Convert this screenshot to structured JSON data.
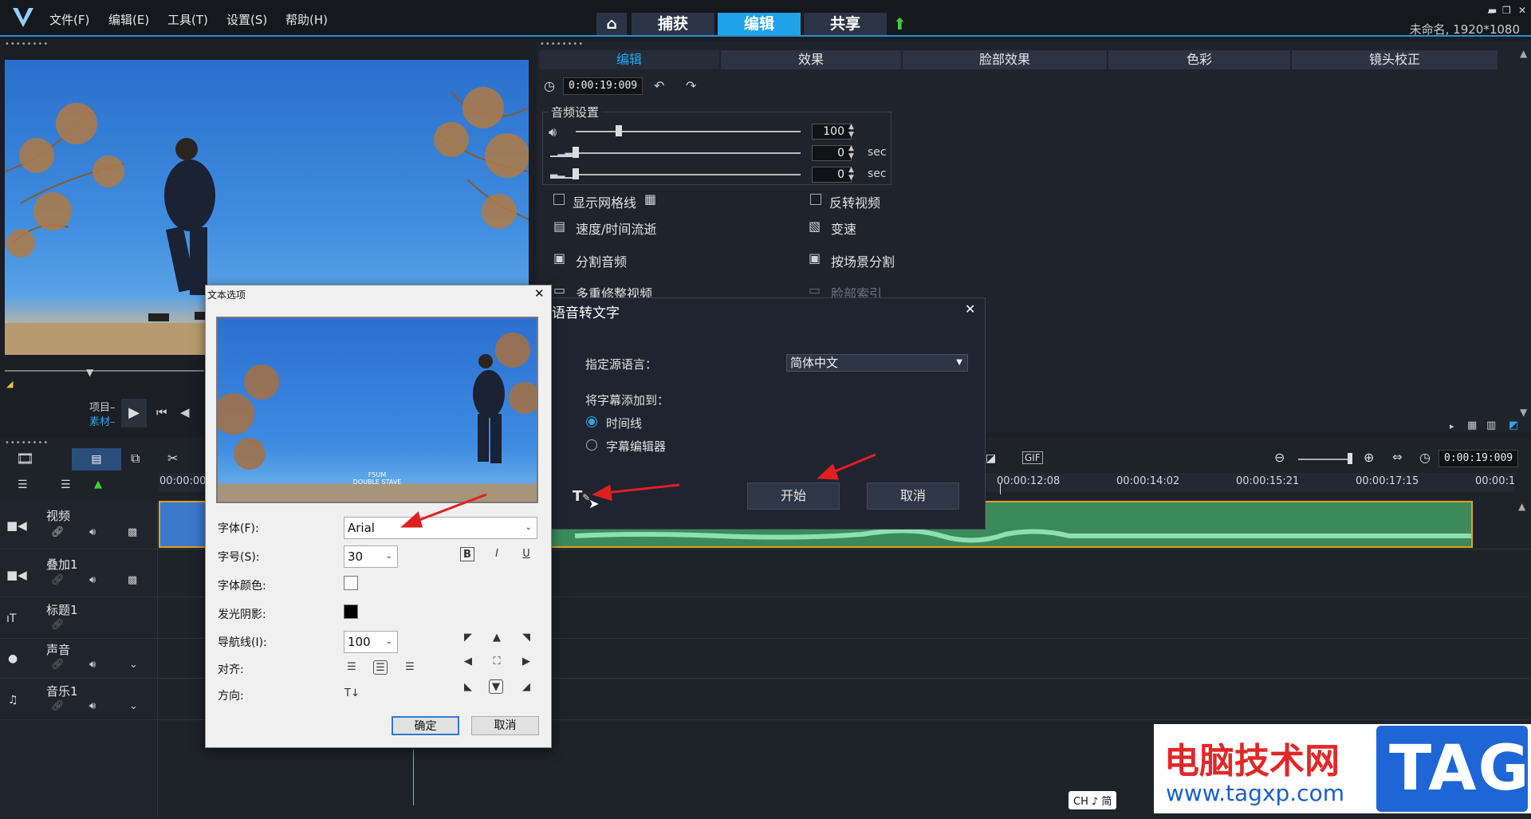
{
  "menubar": {
    "items": [
      "文件(F)",
      "编辑(E)",
      "工具(T)",
      "设置(S)",
      "帮助(H)"
    ],
    "modes": [
      "捕获",
      "编辑",
      "共享"
    ],
    "active_mode": "编辑",
    "project_info": "未命名, 1920*1080"
  },
  "edit_panel": {
    "tabs": [
      "编辑",
      "效果",
      "脸部效果",
      "色彩",
      "镜头校正"
    ],
    "active_tab": "编辑",
    "timecode": "0:00:19:009",
    "audio_group_title": "音频设置",
    "volume_value": "100",
    "fade_in_value": "0",
    "fade_out_value": "0",
    "sec_label": "sec",
    "options_left": [
      "显示网格线",
      "速度/时间流逝",
      "分割音频",
      "多重修整视频"
    ],
    "options_right": [
      "反转视频",
      "变速",
      "按场景分割",
      "脸部索引"
    ]
  },
  "speech_dialog": {
    "title": "语音转文字",
    "source_lang_label": "指定源语言：",
    "source_lang_value": "简体中文",
    "add_to_label": "将字幕添加到：",
    "radio_timeline": "时间线",
    "radio_subtitle_editor": "字幕编辑器",
    "start_button": "开始",
    "cancel_button": "取消"
  },
  "text_dialog": {
    "title": "文本选项",
    "preview_caption_line1": "F5UM",
    "preview_caption_line2": "DOUBLE STAVE",
    "font_label": "字体(F):",
    "font_value": "Arial",
    "size_label": "字号(S):",
    "size_value": "30",
    "color_label": "字体颜色:",
    "shadow_label": "发光阴影:",
    "guide_label": "导航线(I):",
    "guide_value": "100",
    "align_label": "对齐:",
    "direction_label": "方向:",
    "ok_button": "确定",
    "cancel_button": "取消",
    "style_buttons": [
      "B",
      "I",
      "U"
    ],
    "font_color": "#ffffff",
    "shadow_color": "#000000"
  },
  "player": {
    "label_project": "项目",
    "label_clip": "素材"
  },
  "timeline": {
    "ruler_start": "00:00:00",
    "ruler_ticks": [
      "00:00:12:08",
      "00:00:14:02",
      "00:00:15:21",
      "00:00:17:15",
      "00:00:1"
    ],
    "timecode": "0:00:19:009",
    "tracks": [
      "视频",
      "叠加1",
      "标题1",
      "声音",
      "音乐1"
    ]
  },
  "taskbar": {
    "ime": "CH ♪ 简"
  },
  "watermark": {
    "title": "电脑技术网",
    "url": "www.tagxp.com",
    "badge": "TAG"
  },
  "colors": {
    "accent": "#1fa3e8",
    "arrow": "#e02020",
    "audio_clip": "#3c8a5a"
  }
}
